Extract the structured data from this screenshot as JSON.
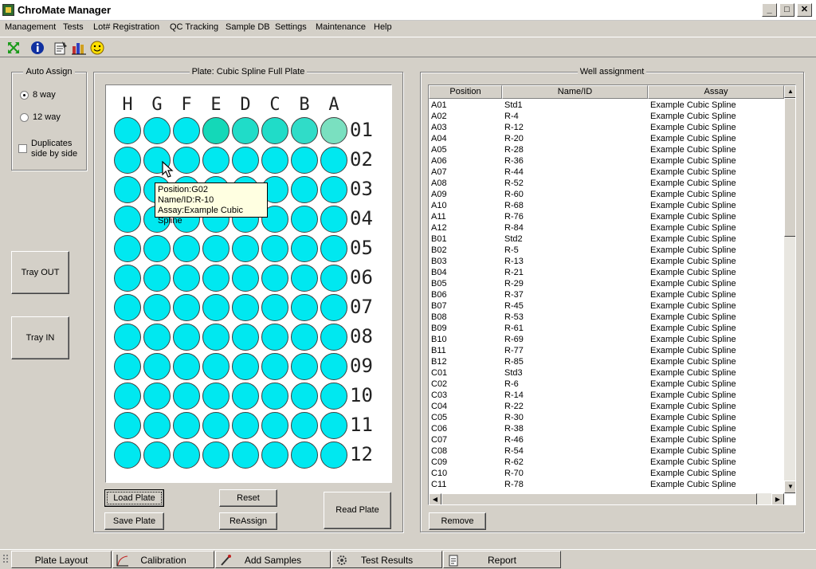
{
  "window": {
    "title": "ChroMate Manager",
    "minimize": "_",
    "maximize": "□",
    "close": "✕"
  },
  "menu": [
    "Management",
    "Tests",
    "Lot# Registration",
    "QC Tracking",
    "Sample DB",
    "Settings",
    "Maintenance",
    "Help"
  ],
  "toolbar_icons": [
    "expand-icon",
    "info-icon",
    "notepad-icon",
    "bar-chart-icon",
    "smiley-icon"
  ],
  "auto_assign": {
    "title": "Auto Assign",
    "option_8": "8 way",
    "option_12": "12 way",
    "duplicates_line1": "Duplicates",
    "duplicates_line2": "side by side",
    "selected": "8 way",
    "duplicates_checked": false
  },
  "tray": {
    "out_label": "Tray OUT",
    "in_label": "Tray IN"
  },
  "plate": {
    "title": "Plate: Cubic Spline Full Plate",
    "columns": [
      "H",
      "G",
      "F",
      "E",
      "D",
      "C",
      "B",
      "A"
    ],
    "rows": [
      "01",
      "02",
      "03",
      "04",
      "05",
      "06",
      "07",
      "08",
      "09",
      "10",
      "11",
      "12"
    ],
    "colors": {
      "default": "#00e8f0",
      "std1": "#7ae0c0",
      "std2": "#14d8b8",
      "std3": "#20dcc8",
      "std4": "#40e0c8",
      "std5": "#1ad2b0"
    },
    "highlighted_wells": [
      {
        "row": 0,
        "col": 3,
        "color": "#14d8b8"
      },
      {
        "row": 0,
        "col": 4,
        "color": "#20dcc8"
      },
      {
        "row": 0,
        "col": 5,
        "color": "#20dcc8"
      },
      {
        "row": 0,
        "col": 6,
        "color": "#30dcc8"
      },
      {
        "row": 0,
        "col": 7,
        "color": "#7ae0c0"
      }
    ],
    "tooltip": {
      "position": "Position:G02",
      "name": "Name/ID:R-10",
      "assay": "Assay:Example Cubic Spline"
    }
  },
  "buttons": {
    "load_plate": "Load Plate",
    "save_plate": "Save Plate",
    "reset": "Reset",
    "reassign": "ReAssign",
    "read_plate": "Read Plate",
    "remove": "Remove"
  },
  "well_assignment": {
    "title": "Well assignment",
    "headers": [
      "Position",
      "Name/ID",
      "Assay"
    ],
    "rows": [
      [
        "A01",
        "Std1",
        "Example Cubic Spline"
      ],
      [
        "A02",
        "R-4",
        "Example Cubic Spline"
      ],
      [
        "A03",
        "R-12",
        "Example Cubic Spline"
      ],
      [
        "A04",
        "R-20",
        "Example Cubic Spline"
      ],
      [
        "A05",
        "R-28",
        "Example Cubic Spline"
      ],
      [
        "A06",
        "R-36",
        "Example Cubic Spline"
      ],
      [
        "A07",
        "R-44",
        "Example Cubic Spline"
      ],
      [
        "A08",
        "R-52",
        "Example Cubic Spline"
      ],
      [
        "A09",
        "R-60",
        "Example Cubic Spline"
      ],
      [
        "A10",
        "R-68",
        "Example Cubic Spline"
      ],
      [
        "A11",
        "R-76",
        "Example Cubic Spline"
      ],
      [
        "A12",
        "R-84",
        "Example Cubic Spline"
      ],
      [
        "B01",
        "Std2",
        "Example Cubic Spline"
      ],
      [
        "B02",
        "R-5",
        "Example Cubic Spline"
      ],
      [
        "B03",
        "R-13",
        "Example Cubic Spline"
      ],
      [
        "B04",
        "R-21",
        "Example Cubic Spline"
      ],
      [
        "B05",
        "R-29",
        "Example Cubic Spline"
      ],
      [
        "B06",
        "R-37",
        "Example Cubic Spline"
      ],
      [
        "B07",
        "R-45",
        "Example Cubic Spline"
      ],
      [
        "B08",
        "R-53",
        "Example Cubic Spline"
      ],
      [
        "B09",
        "R-61",
        "Example Cubic Spline"
      ],
      [
        "B10",
        "R-69",
        "Example Cubic Spline"
      ],
      [
        "B11",
        "R-77",
        "Example Cubic Spline"
      ],
      [
        "B12",
        "R-85",
        "Example Cubic Spline"
      ],
      [
        "C01",
        "Std3",
        "Example Cubic Spline"
      ],
      [
        "C02",
        "R-6",
        "Example Cubic Spline"
      ],
      [
        "C03",
        "R-14",
        "Example Cubic Spline"
      ],
      [
        "C04",
        "R-22",
        "Example Cubic Spline"
      ],
      [
        "C05",
        "R-30",
        "Example Cubic Spline"
      ],
      [
        "C06",
        "R-38",
        "Example Cubic Spline"
      ],
      [
        "C07",
        "R-46",
        "Example Cubic Spline"
      ],
      [
        "C08",
        "R-54",
        "Example Cubic Spline"
      ],
      [
        "C09",
        "R-62",
        "Example Cubic Spline"
      ],
      [
        "C10",
        "R-70",
        "Example Cubic Spline"
      ],
      [
        "C11",
        "R-78",
        "Example Cubic Spline"
      ]
    ]
  },
  "tabs": [
    {
      "label": "Plate Layout",
      "icon": "grip-icon"
    },
    {
      "label": "Calibration",
      "icon": "curve-icon"
    },
    {
      "label": "Add Samples",
      "icon": "pipette-icon"
    },
    {
      "label": "Test Results",
      "icon": "gear-icon"
    },
    {
      "label": "Report",
      "icon": "report-icon"
    }
  ]
}
